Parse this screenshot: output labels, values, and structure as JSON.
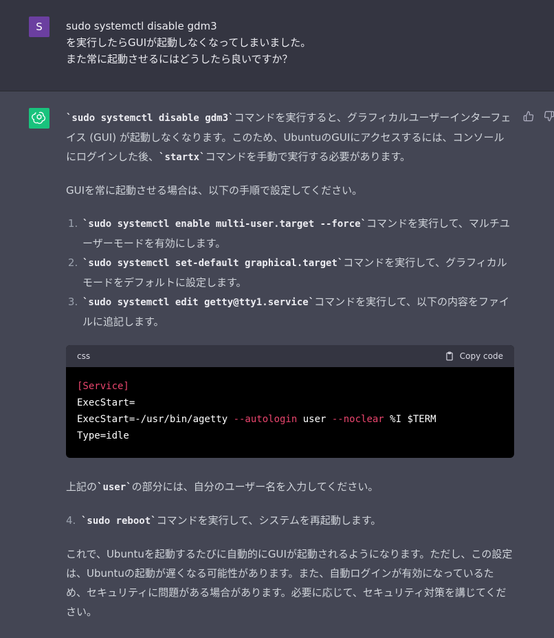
{
  "user": {
    "avatar_letter": "S",
    "lines": [
      "sudo systemctl disable gdm3",
      "を実行したらGUIが起動しなくなってしまいました。",
      "また常に起動させるにはどうしたら良いですか？"
    ]
  },
  "assistant": {
    "intro": {
      "cmd1": "`sudo systemctl disable gdm3`",
      "text1": "コマンドを実行すると、グラフィカルユーザーインターフェイス (GUI) が起動しなくなります。このため、UbuntuのGUIにアクセスするには、コンソールにログインした後、",
      "cmd2": "`startx`",
      "text2": "コマンドを手動で実行する必要があります。"
    },
    "para2": "GUIを常に起動させる場合は、以下の手順で設定してください。",
    "steps": [
      {
        "cmd": "`sudo systemctl enable multi-user.target --force`",
        "text": "コマンドを実行して、マルチユーザーモードを有効にします。"
      },
      {
        "cmd": "`sudo systemctl set-default graphical.target`",
        "text": "コマンドを実行して、グラフィカルモードをデフォルトに設定します。"
      },
      {
        "cmd": "`sudo systemctl edit getty@tty1.service`",
        "text": "コマンドを実行して、以下の内容をファイルに追記します。"
      }
    ],
    "code": {
      "language": "css",
      "copy_label": "Copy code",
      "line1": "[Service]",
      "line2": "ExecStart=",
      "line3_a": "ExecStart=-/usr/bin/agetty ",
      "line3_b": "--autologin",
      "line3_c": " user ",
      "line3_d": "--noclear",
      "line3_e": " %I $TERM",
      "line4": "Type=idle"
    },
    "note": {
      "text1": "上記の",
      "cmd": "`user`",
      "text2": "の部分には、自分のユーザー名を入力してください。"
    },
    "step4": {
      "num": "4.",
      "cmd": "`sudo reboot`",
      "text": "コマンドを実行して、システムを再起動します。"
    },
    "closing": "これで、Ubuntuを起動するたびに自動的にGUIが起動されるようになります。ただし、この設定は、Ubuntuの起動が遅くなる可能性があります。また、自動ログインが有効になっているため、セキュリティに問題がある場合があります。必要に応じて、セキュリティ対策を講じてください。"
  },
  "colors": {
    "user_bg": "#343541",
    "assistant_bg": "#444654",
    "user_avatar": "#6b3fa0",
    "bot_avatar": "#19c37d",
    "code_accent": "#e9456d"
  },
  "icons": [
    "openai-logo-icon",
    "thumbs-up-icon",
    "thumbs-down-icon",
    "clipboard-icon"
  ]
}
